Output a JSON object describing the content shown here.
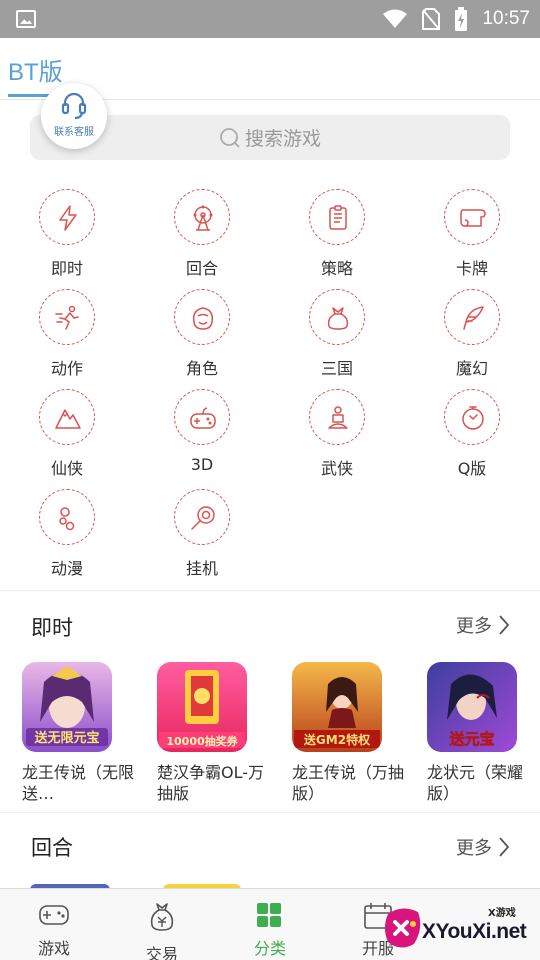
{
  "status_bar": {
    "time": "10:57",
    "icons": [
      "image-icon",
      "wifi-icon",
      "no-sim-icon",
      "battery-charging-icon"
    ]
  },
  "header": {
    "title": "BT版"
  },
  "customer_service": {
    "label": "联系客服",
    "icon": "headset-icon"
  },
  "search": {
    "placeholder": "搜索游戏",
    "icon": "search-icon"
  },
  "categories": [
    {
      "label": "即时",
      "icon": "lightning-icon"
    },
    {
      "label": "回合",
      "icon": "ferris-wheel-icon"
    },
    {
      "label": "策略",
      "icon": "document-icon"
    },
    {
      "label": "卡牌",
      "icon": "scroll-icon"
    },
    {
      "label": "动作",
      "icon": "running-man-icon"
    },
    {
      "label": "角色",
      "icon": "character-icon"
    },
    {
      "label": "三国",
      "icon": "money-bag-icon"
    },
    {
      "label": "魔幻",
      "icon": "feather-icon"
    },
    {
      "label": "仙侠",
      "icon": "mountain-icon"
    },
    {
      "label": "3D",
      "icon": "gamepad-icon"
    },
    {
      "label": "武侠",
      "icon": "martial-artist-icon"
    },
    {
      "label": "Q版",
      "icon": "stopwatch-icon"
    },
    {
      "label": "动漫",
      "icon": "bubbles-icon"
    },
    {
      "label": "挂机",
      "icon": "lollipop-icon"
    }
  ],
  "sections": [
    {
      "title": "即时",
      "more": "更多",
      "games": [
        {
          "name": "龙王传说（无限送…",
          "cover_text": "送无限元宝"
        },
        {
          "name": "楚汉争霸OL-万抽版",
          "cover_text": "10000抽奖券"
        },
        {
          "name": "龙王传说（万抽版）",
          "cover_text": "送GM2特权"
        },
        {
          "name": "龙状元（荣耀版）",
          "cover_text": "送元宝"
        }
      ]
    },
    {
      "title": "回合",
      "more": "更多",
      "games": []
    }
  ],
  "tabbar": [
    {
      "label": "游戏",
      "icon": "gamepad-tab-icon",
      "active": false
    },
    {
      "label": "交易",
      "icon": "money-bag-tab-icon",
      "active": false
    },
    {
      "label": "分类",
      "icon": "grid-tab-icon",
      "active": true
    },
    {
      "label": "开服",
      "icon": "calendar-tab-icon",
      "active": false
    }
  ],
  "watermark": {
    "small": "X游戏",
    "text": "XYouXi.net"
  },
  "colors": {
    "accent_blue": "#5aa1d8",
    "category_red": "#d9534f",
    "active_green": "#3fae4f",
    "status_bar": "#9e9e9e"
  }
}
